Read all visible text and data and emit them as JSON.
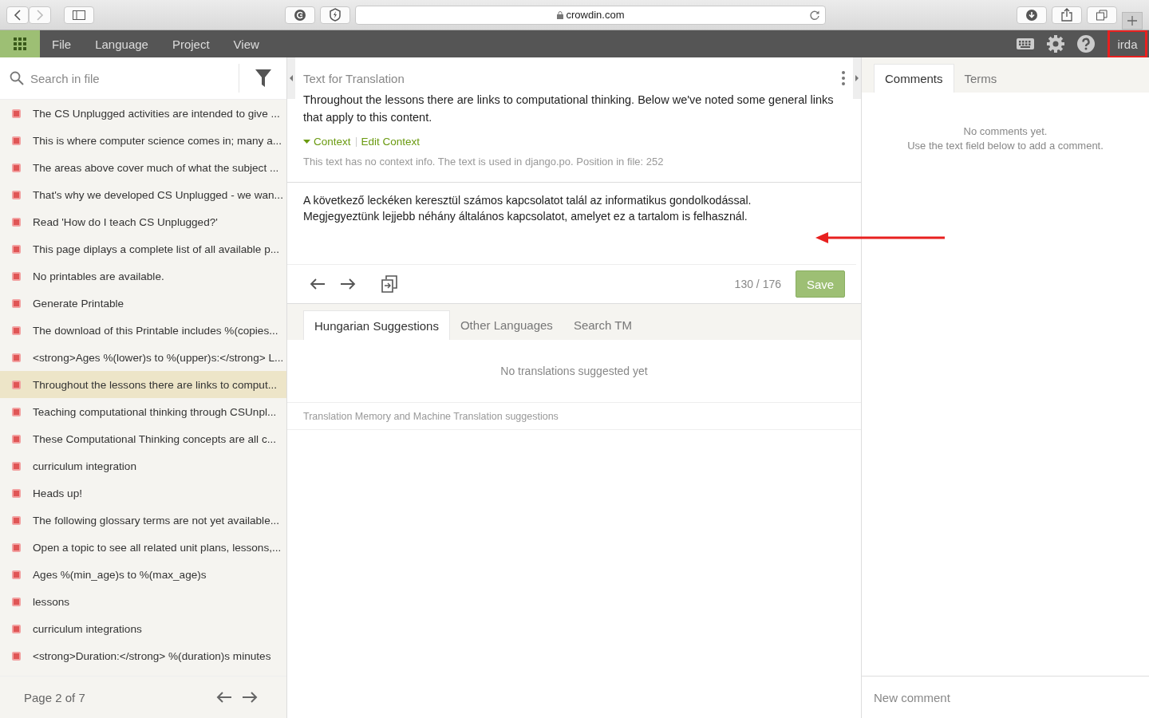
{
  "browser": {
    "url": "crowdin.com"
  },
  "menu": [
    {
      "label": "File"
    },
    {
      "label": "Language"
    },
    {
      "label": "Project"
    },
    {
      "label": "View"
    }
  ],
  "user": {
    "label": "irda",
    "highlighted": true
  },
  "sidebar": {
    "search": {
      "placeholder": "Search in file"
    },
    "items": [
      {
        "text": "The CS Unplugged activities are intended to give ...",
        "selected": false
      },
      {
        "text": "This is where computer science comes in; many a...",
        "selected": false
      },
      {
        "text": "The areas above cover much of what the subject ...",
        "selected": false
      },
      {
        "text": "That's why we developed CS Unplugged - we wan...",
        "selected": false
      },
      {
        "text": "Read 'How do I teach CS Unplugged?'",
        "selected": false
      },
      {
        "text": "This page diplays a complete list of all available p...",
        "selected": false
      },
      {
        "text": "No printables are available.",
        "selected": false
      },
      {
        "text": "Generate Printable",
        "selected": false
      },
      {
        "text": "The download of this Printable includes %(copies...",
        "selected": false
      },
      {
        "text": "<strong>Ages %(lower)s to %(upper)s:</strong> L...",
        "selected": false
      },
      {
        "text": "Throughout the lessons there are links to comput...",
        "selected": true
      },
      {
        "text": "Teaching computational thinking through CSUnpl...",
        "selected": false
      },
      {
        "text": "These Computational Thinking concepts are all c...",
        "selected": false
      },
      {
        "text": "curriculum integration",
        "selected": false
      },
      {
        "text": "Heads up!",
        "selected": false
      },
      {
        "text": "The following glossary terms are not yet available...",
        "selected": false
      },
      {
        "text": "Open a topic to see all related unit plans, lessons,...",
        "selected": false
      },
      {
        "text": "Ages %(min_age)s to %(max_age)s",
        "selected": false
      },
      {
        "text": "lessons",
        "selected": false
      },
      {
        "text": "curriculum integrations",
        "selected": false
      },
      {
        "text": "<strong>Duration:</strong> %(duration)s minutes",
        "selected": false
      }
    ],
    "pager": "Page 2 of 7"
  },
  "editor": {
    "title": "Text for Translation",
    "source": "Throughout the lessons there are links to computational thinking. Below we've noted some general links that apply to this content.",
    "context_toggle": "Context",
    "edit_context": "Edit Context",
    "context_info": "This text has no context info. The text is used in django.po. Position in file: 252",
    "translation": "A következő leckéken keresztül számos kapcsolatot talál az informatikus gondolkodással.\nMegjegyeztünk lejjebb néhány általános kapcsolatot, amelyet ez a tartalom is felhasznál.",
    "counter": "130 / 176",
    "save": "Save",
    "tabs": [
      {
        "label": "Hungarian Suggestions",
        "selected": true
      },
      {
        "label": "Other Languages",
        "selected": false
      },
      {
        "label": "Search TM",
        "selected": false
      }
    ],
    "empty": "No translations suggested yet",
    "tm_label": "Translation Memory and Machine Translation suggestions"
  },
  "comments": {
    "tabs": [
      {
        "label": "Comments",
        "selected": true
      },
      {
        "label": "Terms",
        "selected": false
      }
    ],
    "empty": [
      "No comments yet.",
      "Use the text field below to add a comment."
    ],
    "new_comment": {
      "placeholder": "New comment"
    }
  }
}
